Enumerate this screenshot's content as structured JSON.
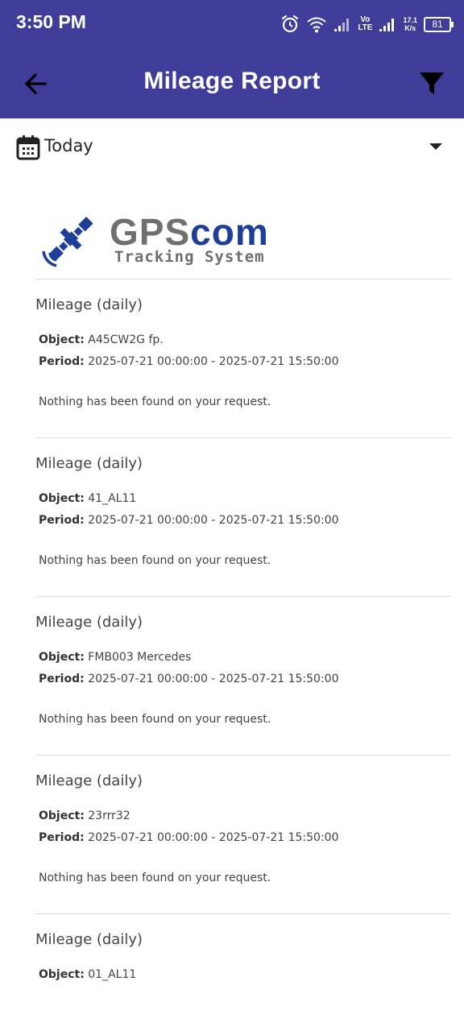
{
  "status_bar": {
    "time": "3:50 PM",
    "volte_top": "Vo",
    "volte_bottom": "LTE",
    "speed_value": "17.1",
    "speed_unit": "K/s",
    "battery": "81"
  },
  "app_bar": {
    "title": "Mileage Report"
  },
  "date_filter": {
    "selected": "Today"
  },
  "logo": {
    "gps": "GPS",
    "com": "com",
    "subtitle": "Tracking System"
  },
  "labels": {
    "object": "Object:",
    "period": "Period:"
  },
  "reports": [
    {
      "title": "Mileage (daily)",
      "object": "A45CW2G fp.",
      "period": "2025-07-21 00:00:00 - 2025-07-21 15:50:00",
      "message": "Nothing has been found on your request."
    },
    {
      "title": "Mileage (daily)",
      "object": "41_AL11",
      "period": "2025-07-21 00:00:00 - 2025-07-21 15:50:00",
      "message": "Nothing has been found on your request."
    },
    {
      "title": "Mileage (daily)",
      "object": "FMB003 Mercedes",
      "period": "2025-07-21 00:00:00 - 2025-07-21 15:50:00",
      "message": "Nothing has been found on your request."
    },
    {
      "title": "Mileage (daily)",
      "object": "23rrr32",
      "period": "2025-07-21 00:00:00 - 2025-07-21 15:50:00",
      "message": "Nothing has been found on your request."
    },
    {
      "title": "Mileage (daily)",
      "object": "01_AL11"
    }
  ],
  "colors": {
    "header": "#3f3d99",
    "logo_blue": "#1d3f9a",
    "logo_gray": "#707070"
  }
}
